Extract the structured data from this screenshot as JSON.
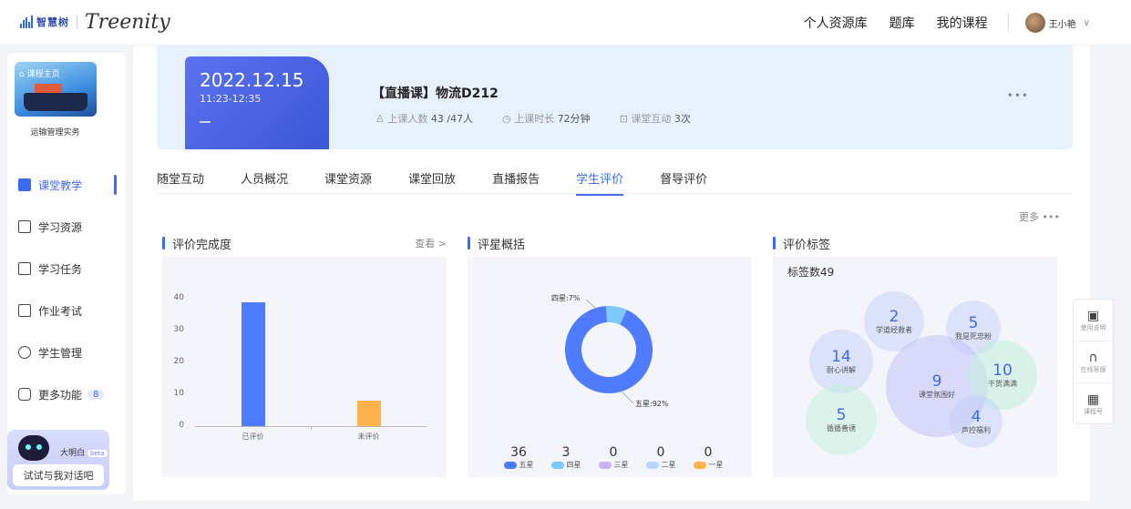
{
  "logo": {
    "brand_cn": "智慧树",
    "brand_en": "Treenity"
  },
  "topnav": {
    "items": [
      "个人资源库",
      "题库",
      "我的课程"
    ],
    "user_name": "王小艳"
  },
  "sidebar": {
    "course_tag": "课程主页",
    "course_name": "运输管理实务",
    "items": [
      {
        "label": "课堂教学",
        "icon": "classroom-icon"
      },
      {
        "label": "学习资源",
        "icon": "resource-icon"
      },
      {
        "label": "学习任务",
        "icon": "task-icon"
      },
      {
        "label": "作业考试",
        "icon": "exam-icon"
      },
      {
        "label": "学生管理",
        "icon": "student-icon"
      },
      {
        "label": "更多功能",
        "icon": "more-icon",
        "badge": "8"
      }
    ],
    "bot_name": "大明白",
    "bot_beta": "beta",
    "bot_button": "试试与我对话吧"
  },
  "banner": {
    "date": "2022.12.15",
    "time": "11:23-12:35",
    "title": "【直播课】物流D212",
    "students_label": "上课人数",
    "students_value": "43 /47人",
    "duration_label": "上课时长",
    "duration_value": "72分钟",
    "interact_label": "课堂互动",
    "interact_value": "3次",
    "more": "•••"
  },
  "tabs": [
    "随堂互动",
    "人员概况",
    "课堂资源",
    "课堂回放",
    "直播报告",
    "学生评价",
    "督导评价"
  ],
  "active_tab": "学生评价",
  "more_link": "更多 •••",
  "panels": {
    "completion": {
      "title": "评价完成度",
      "link": "查看 >"
    },
    "rating": {
      "title": "评星概括"
    },
    "tags": {
      "title": "评价标签",
      "count": "标签数49"
    }
  },
  "chart_data": [
    {
      "type": "bar",
      "categories": [
        "已评价",
        "未评价"
      ],
      "values": [
        39,
        8
      ],
      "ylim": [
        0,
        40
      ],
      "yticks": [
        "0",
        "10",
        "20",
        "30",
        "40"
      ],
      "colors": [
        "#4f7cff",
        "#ffb34f"
      ]
    },
    {
      "type": "pie",
      "labels": [
        "五星",
        "四星",
        "三星",
        "二星",
        "一星"
      ],
      "values": [
        36,
        3,
        0,
        0,
        0
      ],
      "annotations": [
        "四星:7%",
        "五星:92%"
      ],
      "colors": [
        "#4f7cff",
        "#7cc8ff",
        "#c7b3ff",
        "#b8d6ff",
        "#ffb34f"
      ]
    }
  ],
  "tag_bubbles": [
    {
      "value": "2",
      "label": "学道经救者"
    },
    {
      "value": "5",
      "label": "我是死忠粉"
    },
    {
      "value": "14",
      "label": "耐心讲解"
    },
    {
      "value": "9",
      "label": "课堂氛围好"
    },
    {
      "value": "10",
      "label": "干货满满"
    },
    {
      "value": "5",
      "label": "循循善诱"
    },
    {
      "value": "4",
      "label": "声控福利"
    }
  ],
  "tools": [
    {
      "label": "使用说明",
      "icon": "manual-icon"
    },
    {
      "label": "在线客服",
      "icon": "headset-icon"
    },
    {
      "label": "课程号",
      "icon": "qrcode-icon"
    }
  ]
}
